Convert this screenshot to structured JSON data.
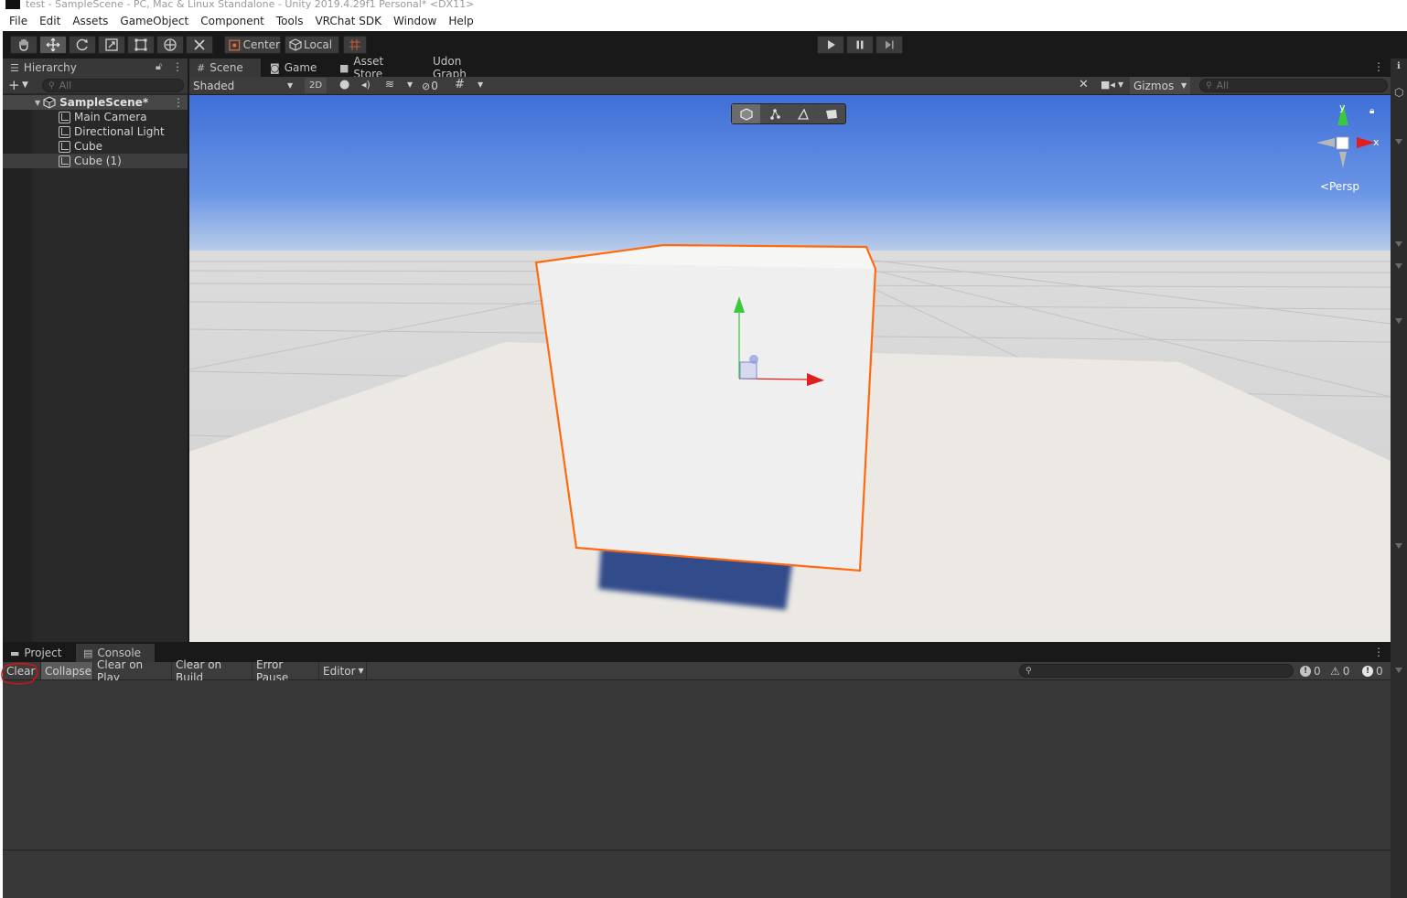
{
  "window": {
    "title": "test - SampleScene - PC, Mac & Linux Standalone - Unity 2019.4.29f1 Personal* <DX11>"
  },
  "menu": [
    "File",
    "Edit",
    "Assets",
    "GameObject",
    "Component",
    "Tools",
    "VRChat SDK",
    "Window",
    "Help"
  ],
  "toolbar": {
    "tools": [
      "hand-tool",
      "move-tool",
      "rotate-tool",
      "scale-tool",
      "rect-tool",
      "transform-tool",
      "custom-tool"
    ],
    "pivot_label": "Center",
    "space_label": "Local"
  },
  "hierarchy": {
    "tab_label": "Hierarchy",
    "search_placeholder": "All",
    "scene_name": "SampleScene*",
    "items": [
      {
        "label": "Main Camera",
        "selected": false
      },
      {
        "label": "Directional Light",
        "selected": false
      },
      {
        "label": "Cube",
        "selected": false
      },
      {
        "label": "Cube (1)",
        "selected": true
      }
    ]
  },
  "scene": {
    "tabs": [
      {
        "label": "Scene",
        "icon": "grid-icon",
        "active": true
      },
      {
        "label": "Game",
        "icon": "gamepad-icon",
        "active": false
      },
      {
        "label": "Asset Store",
        "icon": "bag-icon",
        "active": false
      },
      {
        "label": "Udon Graph",
        "icon": "",
        "active": false
      }
    ],
    "draw_mode": "Shaded",
    "mode_2d": "2D",
    "hidden_count": "0",
    "gizmos_label": "Gizmos",
    "search_placeholder": "All",
    "projection_label": "Persp",
    "axis_y": "y",
    "axis_x": "x"
  },
  "console": {
    "tabs": [
      {
        "label": "Project",
        "icon": "folder-icon",
        "active": false
      },
      {
        "label": "Console",
        "icon": "console-icon",
        "active": true
      }
    ],
    "buttons": [
      {
        "label": "Clear",
        "on": false
      },
      {
        "label": "Collapse",
        "on": true
      },
      {
        "label": "Clear on Play",
        "on": false
      },
      {
        "label": "Clear on Build",
        "on": false
      },
      {
        "label": "Error Pause",
        "on": false
      },
      {
        "label": "Editor",
        "on": false
      }
    ],
    "log_count": "0",
    "warning_count": "0",
    "error_count": "0"
  },
  "colors": {
    "selection_outline": "#ff6a10",
    "annotation": "#e01010",
    "axis_x": "#e02020",
    "axis_y": "#30c030",
    "axis_z": "#3050e0"
  }
}
